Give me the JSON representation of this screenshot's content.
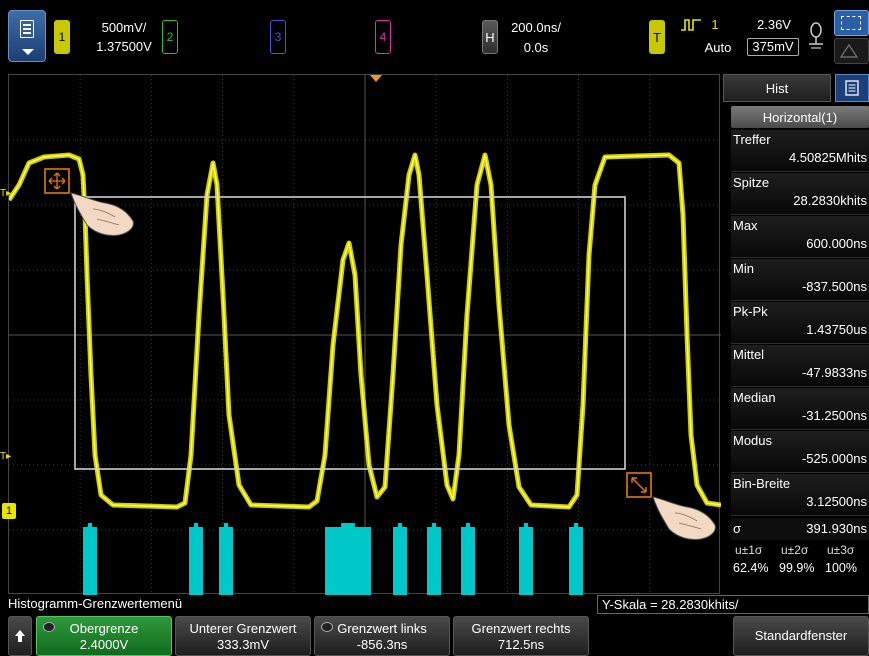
{
  "top": {
    "ch1": {
      "num": "1",
      "scale": "500mV/",
      "offset": "1.37500V",
      "color": "#c8c800"
    },
    "ch2": {
      "num": "2",
      "color": "#23c23a"
    },
    "ch3": {
      "num": "3",
      "color": "#3a5bd8"
    },
    "ch4": {
      "num": "4",
      "color": "#d436a8"
    },
    "horizontal": {
      "label": "H",
      "scale": "200.0ns/",
      "delay": "0.0s"
    },
    "trigger": {
      "label": "T",
      "source": "1",
      "mode": "Auto",
      "level": "2.36V",
      "level2": "375mV"
    }
  },
  "panel": {
    "tab_hist": "Hist",
    "horizontal_label": "Horizontal(1)",
    "stats": [
      {
        "label": "Treffer",
        "value": "4.50825Mhits"
      },
      {
        "label": "Spitze",
        "value": "28.2830khits"
      },
      {
        "label": "Max",
        "value": "600.000ns"
      },
      {
        "label": "Min",
        "value": "-837.500ns"
      },
      {
        "label": "Pk-Pk",
        "value": "1.43750us"
      },
      {
        "label": "Mittel",
        "value": "-47.9833ns"
      },
      {
        "label": "Median",
        "value": "-31.2500ns"
      },
      {
        "label": "Modus",
        "value": "-525.000ns"
      },
      {
        "label": "Bin-Breite",
        "value": "3.12500ns"
      }
    ],
    "sigma": {
      "label": "σ",
      "value": "391.930ns"
    },
    "sigma_heads": [
      "u±1σ",
      "u±2σ",
      "u±3σ"
    ],
    "sigma_vals": [
      "62.4%",
      "99.9%",
      "100%"
    ]
  },
  "bottom": {
    "menu_title": "Histogramm-Grenzwertemenü",
    "yscale": "Y-Skala = 28.2830khits/",
    "softkeys": [
      {
        "label": "Obergrenze",
        "value": "2.4000V"
      },
      {
        "label": "Unterer Grenzwert",
        "value": "333.3mV"
      },
      {
        "label": "Grenzwert links",
        "value": "-856.3ns"
      },
      {
        "label": "Grenzwert rechts",
        "value": "712.5ns"
      },
      {
        "label": "Standardfenster",
        "value": ""
      }
    ]
  },
  "markers": {
    "trig_upper": "T",
    "trig_lower": "T",
    "ch1_ground": "1"
  },
  "colors": {
    "trace": "#e6e600",
    "histogram": "#00c8c8",
    "grid": "#3a3a3a"
  }
}
